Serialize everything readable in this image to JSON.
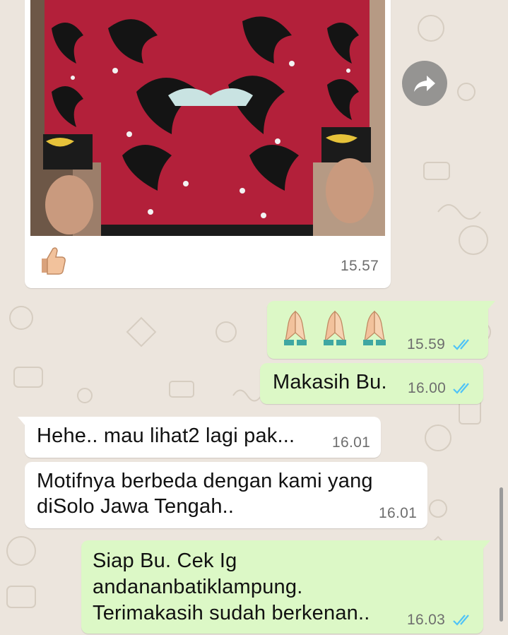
{
  "colors": {
    "background": "#ece5dd",
    "incoming_bubble": "#ffffff",
    "outgoing_bubble": "#dcf8c6",
    "read_ticks": "#4fc3f7",
    "timestamp": "#6e6e6e"
  },
  "messages": [
    {
      "id": "m1",
      "direction": "incoming",
      "type": "image",
      "caption_emoji": "thumbs-up",
      "time": "15.57"
    },
    {
      "id": "m2",
      "direction": "outgoing",
      "type": "emoji",
      "emoji": "folded-hands x3",
      "time": "15.59",
      "status": "read"
    },
    {
      "id": "m3",
      "direction": "outgoing",
      "text": "Makasih Bu.",
      "time": "16.00",
      "status": "read"
    },
    {
      "id": "m4",
      "direction": "incoming",
      "text": "Hehe.. mau lihat2 lagi pak...",
      "time": "16.01"
    },
    {
      "id": "m5",
      "direction": "incoming",
      "lines": [
        "Motifnya berbeda dengan kami yang",
        "diSolo Jawa Tengah.."
      ],
      "time": "16.01"
    },
    {
      "id": "m6",
      "direction": "outgoing",
      "lines": [
        "Siap Bu. Cek Ig",
        "andananbatiklampung.",
        "Terimakasih sudah berkenan.."
      ],
      "time": "16.03",
      "status": "read"
    }
  ],
  "icons": {
    "forward": "forward-arrow-icon",
    "read_status": "double-check-icon"
  }
}
